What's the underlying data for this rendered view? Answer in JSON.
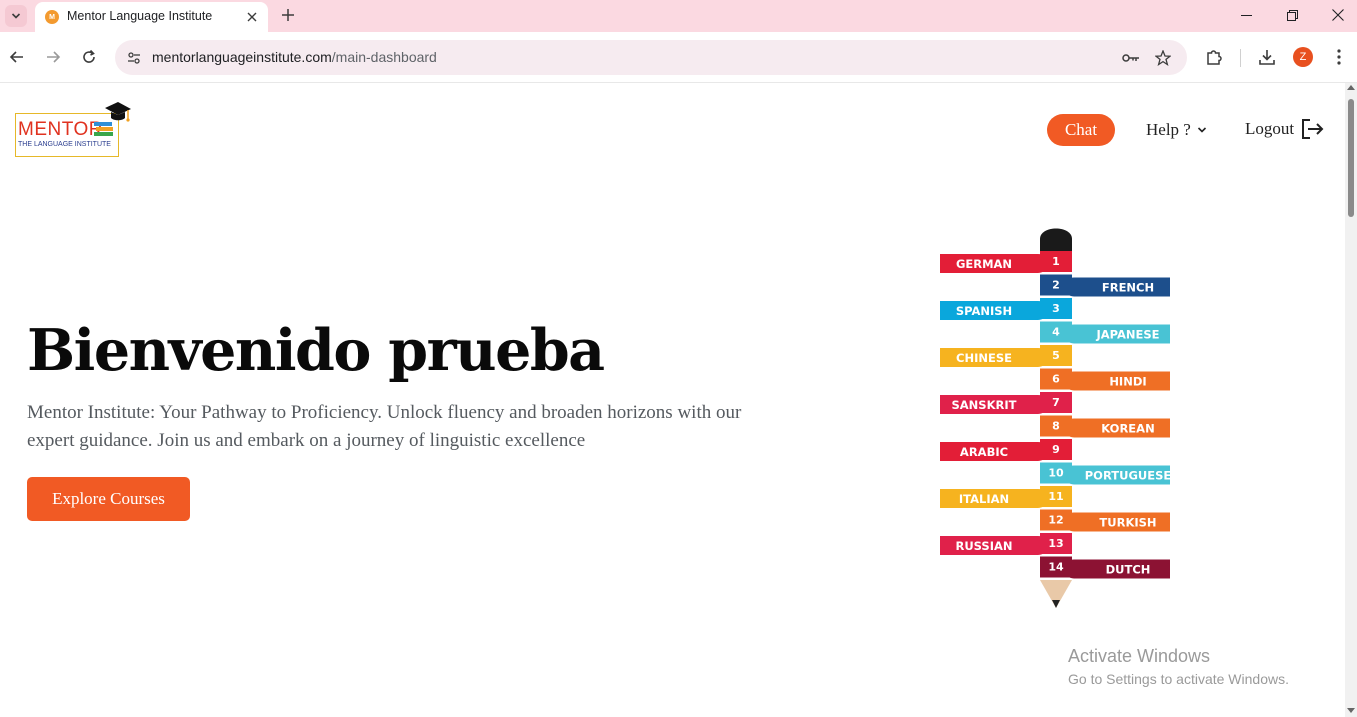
{
  "browser": {
    "tab_title": "Mentor Language Institute",
    "url_host": "mentorlanguageinstitute.com",
    "url_path": "/main-dashboard",
    "profile_initial": "Z"
  },
  "header": {
    "logo_word": "MENTOR",
    "logo_tagline": "THE LANGUAGE INSTITUTE",
    "chat_label": "Chat",
    "help_label": "Help ?",
    "logout_label": "Logout"
  },
  "hero": {
    "title": "Bienvenido prueba",
    "subtitle": "Mentor Institute: Your Pathway to Proficiency. Unlock fluency and broaden horizons with our expert guidance. Join us and embark on a journey of linguistic excellence",
    "cta_label": "Explore Courses"
  },
  "languages": [
    {
      "num": "1",
      "name": "GERMAN",
      "side": "left",
      "color": "#e31e37"
    },
    {
      "num": "2",
      "name": "FRENCH",
      "side": "right",
      "color": "#1d4f8c"
    },
    {
      "num": "3",
      "name": "SPANISH",
      "side": "left",
      "color": "#0aa7dc"
    },
    {
      "num": "4",
      "name": "JAPANESE",
      "side": "right",
      "color": "#49c3d4"
    },
    {
      "num": "5",
      "name": "CHINESE",
      "side": "left",
      "color": "#f6b31f"
    },
    {
      "num": "6",
      "name": "HINDI",
      "side": "right",
      "color": "#ef6f25"
    },
    {
      "num": "7",
      "name": "SANSKRIT",
      "side": "left",
      "color": "#e0214a"
    },
    {
      "num": "8",
      "name": "KOREAN",
      "side": "right",
      "color": "#ef6f25"
    },
    {
      "num": "9",
      "name": "ARABIC",
      "side": "left",
      "color": "#e31e37"
    },
    {
      "num": "10",
      "name": "PORTUGUESE",
      "side": "right",
      "color": "#49c3d4"
    },
    {
      "num": "11",
      "name": "ITALIAN",
      "side": "left",
      "color": "#f6b31f"
    },
    {
      "num": "12",
      "name": "TURKISH",
      "side": "right",
      "color": "#ef6f25"
    },
    {
      "num": "13",
      "name": "RUSSIAN",
      "side": "left",
      "color": "#e0214a"
    },
    {
      "num": "14",
      "name": "DUTCH",
      "side": "right",
      "color": "#8c1233"
    }
  ],
  "watermark": {
    "title": "Activate Windows",
    "subtitle": "Go to Settings to activate Windows."
  },
  "colors": {
    "accent": "#f15a24",
    "tabbar": "#fbd9e1"
  }
}
